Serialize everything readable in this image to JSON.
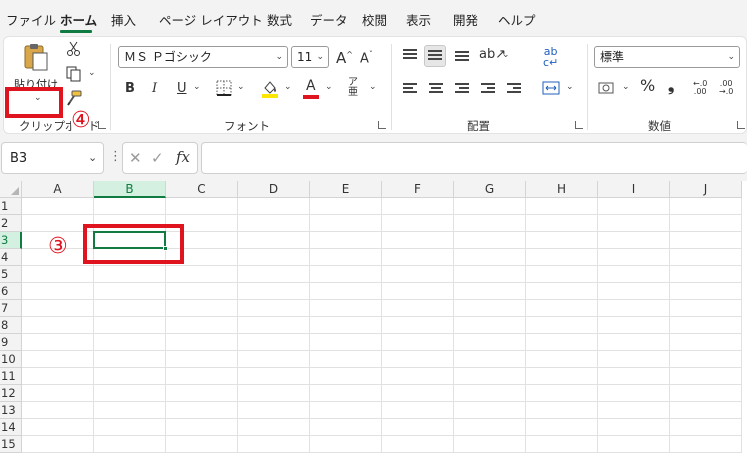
{
  "tabs": [
    "ファイル",
    "ホーム",
    "挿入",
    "ページ レイアウト",
    "数式",
    "データ",
    "校閲",
    "表示",
    "開発",
    "ヘルプ"
  ],
  "active_tab": "ホーム",
  "ribbon": {
    "clipboard": {
      "paste_label": "貼り付け",
      "group_label": "クリップボード"
    },
    "font": {
      "font_name": "ＭＳ Ｐゴシック",
      "font_size": "11",
      "bold": "B",
      "italic": "I",
      "underline": "U",
      "font_color_glyph": "A",
      "fill_color": "#ffe600",
      "font_color": "#e0141e",
      "group_label": "フォント"
    },
    "alignment": {
      "group_label": "配置"
    },
    "number": {
      "format": "標準",
      "percent": "%",
      "comma": "❟",
      "group_label": "数値"
    }
  },
  "formula_bar": {
    "name_box": "B3",
    "cancel": "✕",
    "enter": "✓",
    "fx": "fx",
    "formula": ""
  },
  "sheet": {
    "columns": [
      "A",
      "B",
      "C",
      "D",
      "E",
      "F",
      "G",
      "H",
      "I",
      "J"
    ],
    "rows": [
      "1",
      "2",
      "3",
      "4",
      "5",
      "6",
      "7",
      "8",
      "9",
      "10",
      "11",
      "12",
      "13",
      "14",
      "15"
    ],
    "selected_cell": "B3"
  },
  "annotations": {
    "step3": "③",
    "step4": "④",
    "color": "#e0141e"
  }
}
